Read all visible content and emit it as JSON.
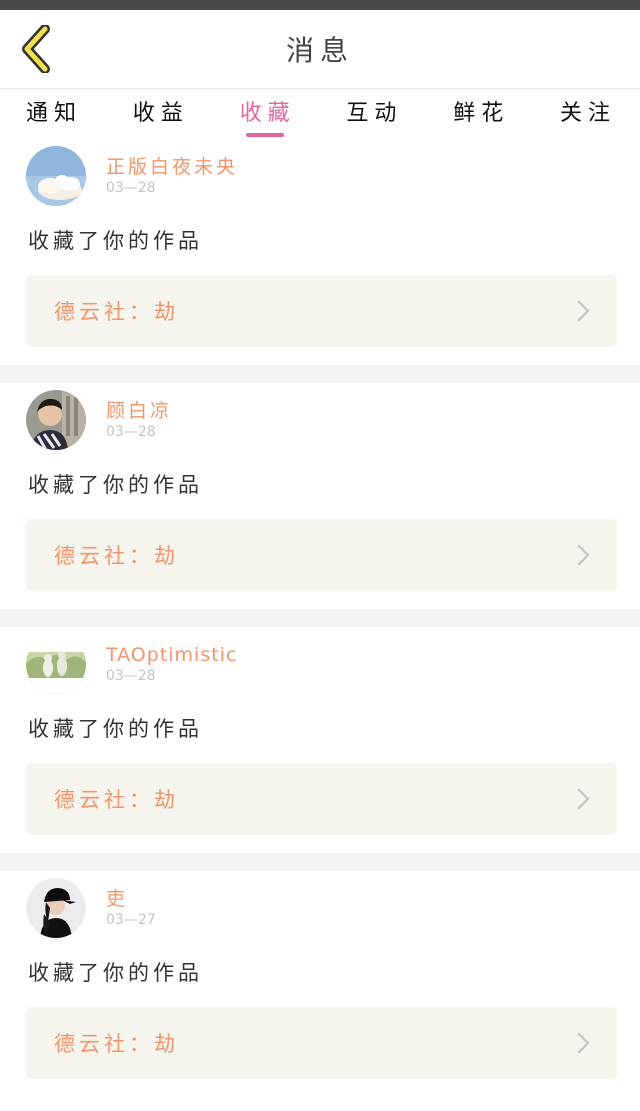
{
  "header": {
    "title": "消息"
  },
  "tabs": [
    {
      "label": "通知",
      "active": false
    },
    {
      "label": "收益",
      "active": false
    },
    {
      "label": "收藏",
      "active": true
    },
    {
      "label": "互动",
      "active": false
    },
    {
      "label": "鲜花",
      "active": false
    },
    {
      "label": "关注",
      "active": false
    }
  ],
  "messages": [
    {
      "username": "正版白夜未央",
      "date": "03—28",
      "action": "收藏了你的作品",
      "work": "德云社：劫",
      "avatar_icon": "sky-cloud-avatar"
    },
    {
      "username": "顾白凉",
      "date": "03—28",
      "action": "收藏了你的作品",
      "work": "德云社：劫",
      "avatar_icon": "person-avatar"
    },
    {
      "username": "TAOptimistic",
      "date": "03—28",
      "action": "收藏了你的作品",
      "work": "德云社：劫",
      "avatar_icon": "garden-avatar"
    },
    {
      "username": "吏",
      "date": "03—27",
      "action": "收藏了你的作品",
      "work": "德云社：劫",
      "avatar_icon": "girl-cap-avatar"
    }
  ],
  "colors": {
    "accent_pink": "#e066a0",
    "accent_orange": "#f0956a",
    "back_icon": "#f3e04a",
    "card_link_bg": "#f5f5ee"
  }
}
